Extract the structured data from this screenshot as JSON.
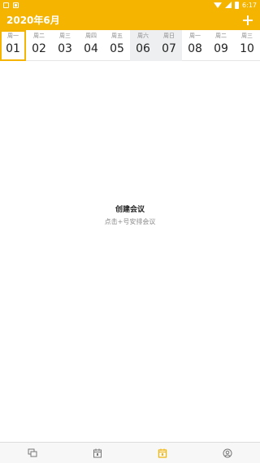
{
  "status_bar": {
    "time": "6:17"
  },
  "header": {
    "title": "2020年6月",
    "add_label": "+"
  },
  "week": [
    {
      "weekday": "周一",
      "date": "01",
      "selected": true,
      "weekend": false
    },
    {
      "weekday": "周二",
      "date": "02",
      "selected": false,
      "weekend": false
    },
    {
      "weekday": "周三",
      "date": "03",
      "selected": false,
      "weekend": false
    },
    {
      "weekday": "周四",
      "date": "04",
      "selected": false,
      "weekend": false
    },
    {
      "weekday": "周五",
      "date": "05",
      "selected": false,
      "weekend": false
    },
    {
      "weekday": "周六",
      "date": "06",
      "selected": false,
      "weekend": true
    },
    {
      "weekday": "周日",
      "date": "07",
      "selected": false,
      "weekend": true
    },
    {
      "weekday": "周一",
      "date": "08",
      "selected": false,
      "weekend": false
    },
    {
      "weekday": "周二",
      "date": "09",
      "selected": false,
      "weekend": false
    },
    {
      "weekday": "周三",
      "date": "10",
      "selected": false,
      "weekend": false
    }
  ],
  "empty_state": {
    "title": "创建会议",
    "subtitle": "点击+号安排会议"
  },
  "bottom_nav": [
    {
      "icon": "chat-icon",
      "active": false
    },
    {
      "icon": "calendar-icon",
      "active": false
    },
    {
      "icon": "schedule-icon",
      "active": true
    },
    {
      "icon": "profile-icon",
      "active": false
    }
  ],
  "colors": {
    "accent": "#f4b400",
    "weekend_bg": "#eeeff1",
    "text": "#222222",
    "muted": "#8a8a8a"
  }
}
